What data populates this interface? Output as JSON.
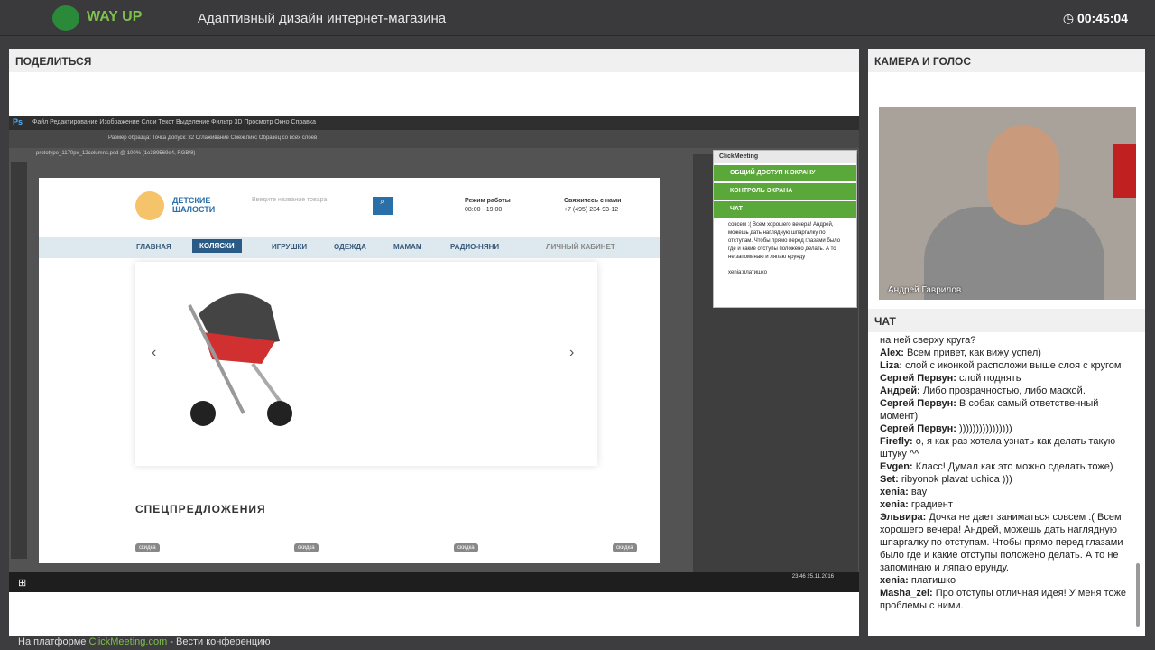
{
  "app": {
    "logo": "WAY UP",
    "title": "Адаптивный дизайн интернет-магазина",
    "timer": "00:45:04"
  },
  "share": {
    "heading": "ПОДЕЛИТЬСЯ"
  },
  "camera": {
    "heading": "КАМЕРА И ГОЛОС",
    "presenter": "Андрей Гаврилов"
  },
  "chat": {
    "heading": "ЧАТ",
    "messages": [
      {
        "user": "",
        "text": "на ней сверху круга?"
      },
      {
        "user": "Alex:",
        "text": "Всем привет, как вижу успел)"
      },
      {
        "user": "Liza:",
        "text": "слой с иконкой расположи выше слоя с кругом"
      },
      {
        "user": "Сергей Первун:",
        "text": "слой поднять"
      },
      {
        "user": "Андрей:",
        "text": "Либо прозрачностью, либо маской."
      },
      {
        "user": "Сергей Первун:",
        "text": "В собак самый ответственный момент)"
      },
      {
        "user": "Сергей Первун:",
        "text": "))))))))))))))))"
      },
      {
        "user": "Firefly:",
        "text": "о, я как раз хотела узнать как делать такую штуку ^^"
      },
      {
        "user": "Evgen:",
        "text": "Класс! Думал как это можно сделать тоже)"
      },
      {
        "user": "Set:",
        "text": "ribyonok plavat uchica )))"
      },
      {
        "user": "xenia:",
        "text": "вау"
      },
      {
        "user": "xenia:",
        "text": "градиент"
      },
      {
        "user": "Эльвира:",
        "text": "Дочка не дает заниматься совсем :( Всем хорошего вечера! Андрей, можешь дать наглядную шпаргалку по отступам. Чтобы прямо перед глазами было где и какие отступы положено делать. А то не запоминаю и ляпаю ерунду."
      },
      {
        "user": "xenia:",
        "text": "платишко"
      },
      {
        "user": "Masha_zel:",
        "text": "Про отступы отличная идея! У меня тоже проблемы с ними."
      }
    ]
  },
  "footer": {
    "prefix": "На платформе",
    "brand": "ClickMeeting.com",
    "suffix": "- Вести конференцию"
  },
  "photoshop": {
    "menu": "Файл   Редактирование   Изображение   Слои   Текст   Выделение   Фильтр   3D   Просмотр   Окно   Справка",
    "options": "Размер образца:   Точка        Допуск: 32     Сглаживание     Смеж.пикс     Образец со всех слоев",
    "tab": "prototype_1170px_12columns.psd @ 100% (1e389569e4, RGB/8)",
    "date": "23:46\n25.11.2016"
  },
  "site": {
    "brand": "ДЕТСКИЕ ШАЛОСТИ",
    "search_placeholder": "Введите название товара",
    "hours_label": "Режим работы",
    "hours": "08:00 - 19:00",
    "contact_label": "Свяжитесь с нами",
    "phone": "+7 (495) 234-93-12",
    "nav": [
      "ГЛАВНАЯ",
      "КОЛЯСКИ",
      "ИГРУШКИ",
      "ОДЕЖДА",
      "МАМАМ",
      "РАДИО-НЯНИ",
      "ЛИЧНЫЙ КАБИНЕТ"
    ],
    "offers": "СПЕЦПРЕДЛОЖЕНИЯ",
    "sale": "скидка"
  },
  "clickmeeting": {
    "title": "ClickMeeting",
    "share_screen": "ОБЩИЙ ДОСТУП К ЭКРАНУ",
    "control": "КОНТРОЛЬ ЭКРАНА",
    "chat": "ЧАТ",
    "msg": "совсем :( Всем хорошего вечера! Андрей, можешь дать наглядную шпаргалку по отступам. Чтобы прямо перед глазами было где и какие отступы положено делать. А то не запоминаю и ляпаю ерунду",
    "last": "xenia:платишко",
    "send": "ОТПРА"
  }
}
